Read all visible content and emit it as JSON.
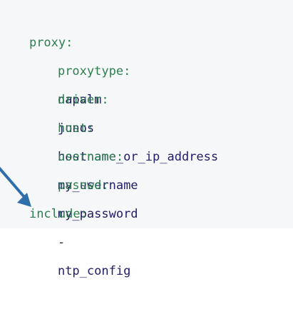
{
  "yaml": {
    "proxy_key": "proxy:",
    "proxytype_key": "proxytype:",
    "proxytype_value": "napalm",
    "driver_key": "driver:",
    "driver_value": "junos",
    "host_key": "host:",
    "host_value": "hostname_or_ip_address",
    "username_key": "username:",
    "username_value": "my_username",
    "passwd_key": "passwd:",
    "passwd_value": "my_password",
    "include_key": "include:",
    "list_marker": "-",
    "include_value": "ntp_config"
  },
  "colors": {
    "background": "#f6f7f8",
    "key": "#2e7d4f",
    "value": "#1e1e66",
    "annotation_arrow": "#2f6eaa"
  },
  "annotation": {
    "icon": "arrow-icon"
  }
}
